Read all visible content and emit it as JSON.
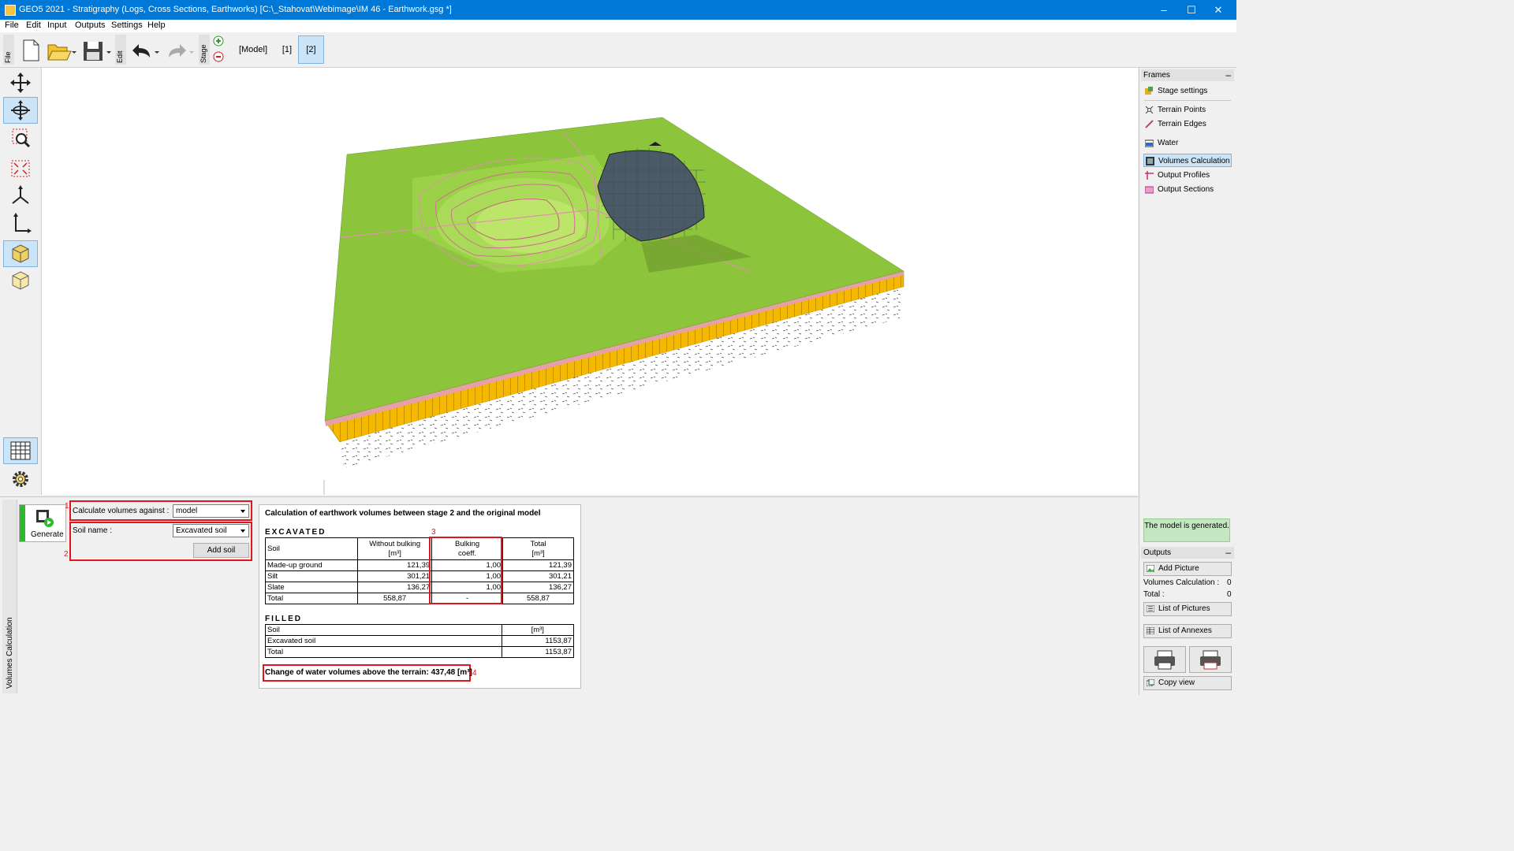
{
  "window": {
    "title": "GEO5 2021 - Stratigraphy (Logs, Cross Sections, Earthworks) [C:\\_Stahovat\\Webimage\\IM 46 - Earthwork.gsg *]",
    "minimize": "–",
    "maximize": "☐",
    "close": "✕"
  },
  "menu": [
    "File",
    "Edit",
    "Input",
    "Outputs",
    "Settings",
    "Help"
  ],
  "toolbar": {
    "file_label": "File",
    "edit_label": "Edit",
    "stage_label": "Stage",
    "stages": [
      "[Model]",
      "[1]",
      "[2]"
    ],
    "active_stage": "[2]"
  },
  "left_tools": [
    "move-tool",
    "rotate-tool",
    "zoom-tool",
    "fit-view-tool",
    "axes-3d-tool",
    "axes-2d-tool",
    "box-view-tool",
    "box-wire-tool",
    "table-tool",
    "settings-tool"
  ],
  "frames": {
    "header": "Frames",
    "collapse": "–",
    "items": [
      {
        "label": "Stage settings",
        "icon": "stage-settings-icon",
        "selected": false
      },
      {
        "label": "Terrain Points",
        "icon": "terrain-points-icon",
        "selected": false
      },
      {
        "label": "Terrain Edges",
        "icon": "terrain-edges-icon",
        "selected": false
      },
      {
        "label": "Water",
        "icon": "water-icon",
        "selected": false
      },
      {
        "label": "Volumes Calculation",
        "icon": "volumes-calculation-icon",
        "selected": true
      },
      {
        "label": "Output Profiles",
        "icon": "output-profiles-icon",
        "selected": false
      },
      {
        "label": "Output Sections",
        "icon": "output-sections-icon",
        "selected": false
      }
    ]
  },
  "status_box": "The model is generated.",
  "outputs": {
    "header": "Outputs",
    "collapse": "–",
    "add_picture": "Add Picture",
    "volumes_label": "Volumes Calculation :",
    "volumes_value": "0",
    "total_label": "Total :",
    "total_value": "0",
    "list_pictures": "List of Pictures",
    "list_annexes": "List of Annexes",
    "copy_view": "Copy view"
  },
  "bottom": {
    "tab_label": "Volumes Calculation",
    "generate": "Generate",
    "calc_against_label": "Calculate volumes against :",
    "calc_against_value": "model",
    "soil_name_label": "Soil name :",
    "soil_name_value": "Excavated soil",
    "add_soil": "Add soil",
    "markers": [
      "1",
      "2",
      "3",
      "4"
    ]
  },
  "result": {
    "title": "Calculation of earthwork volumes between stage 2 and the original model",
    "excavated_heading": "EXCAVATED",
    "excavated_cols": [
      "Soil",
      "Without bulking\n[m³]",
      "Bulking\ncoeff.",
      "Total\n[m³]"
    ],
    "excavated_rows": [
      [
        "Made-up ground",
        "121,39",
        "1,00",
        "121,39"
      ],
      [
        "Silt",
        "301,21",
        "1,00",
        "301,21"
      ],
      [
        "Slate",
        "136,27",
        "1,00",
        "136,27"
      ],
      [
        "Total",
        "558,87",
        "-",
        "558,87"
      ]
    ],
    "filled_heading": "FILLED",
    "filled_cols": [
      "Soil",
      "[m³]"
    ],
    "filled_rows": [
      [
        "Excavated soil",
        "1153,87"
      ],
      [
        "Total",
        "1153,87"
      ]
    ],
    "water_change": "Change of water volumes above the terrain: 437,48 [m³]"
  },
  "colors": {
    "titlebar": "#0078d7",
    "terrain": "#8cc43c",
    "layer_yellow": "#f5b800",
    "highlight_red": "#e0161e",
    "selection": "#cce4f7"
  }
}
